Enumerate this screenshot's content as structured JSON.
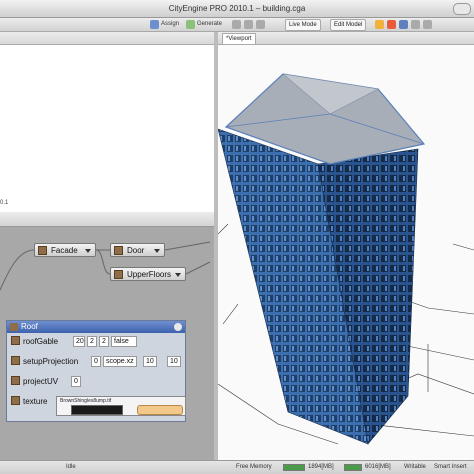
{
  "window": {
    "title": "CityEngine PRO 2010.1 – building.cga"
  },
  "toolbar": {
    "assign_label": "Assign",
    "generate_label": "Generate",
    "live_mode_label": "Live Mode",
    "edit_model_label": "Edit Model"
  },
  "left_pane": {
    "code_fragment": "0.1"
  },
  "viewport": {
    "tab_label": "*Viewport"
  },
  "graph": {
    "nodes": [
      {
        "label": "Facade"
      },
      {
        "label": "Door"
      },
      {
        "label": "UpperFloors"
      }
    ]
  },
  "inspector": {
    "title": "Roof",
    "params": [
      {
        "label": "roofGable",
        "values": [
          "20",
          "2",
          "2",
          "false"
        ]
      },
      {
        "label": "setupProjection",
        "values": [
          "0",
          "scope.xz",
          "10",
          "10"
        ]
      },
      {
        "label": "projectUV",
        "values": [
          "0"
        ]
      },
      {
        "label": "texture",
        "values": []
      }
    ],
    "texture_path": "BrownShingles8ump.tif"
  },
  "status": {
    "state": "Idle",
    "free_memory_label": "Free Memory",
    "mem1": "1894[MB]",
    "mem2": "6016[MB]",
    "writable": "Writable",
    "insert": "Smart Insert"
  },
  "colors": {
    "accent": "#3e63ad",
    "building": "#3b6fb0",
    "graph_bg": "#a8a8a8"
  }
}
